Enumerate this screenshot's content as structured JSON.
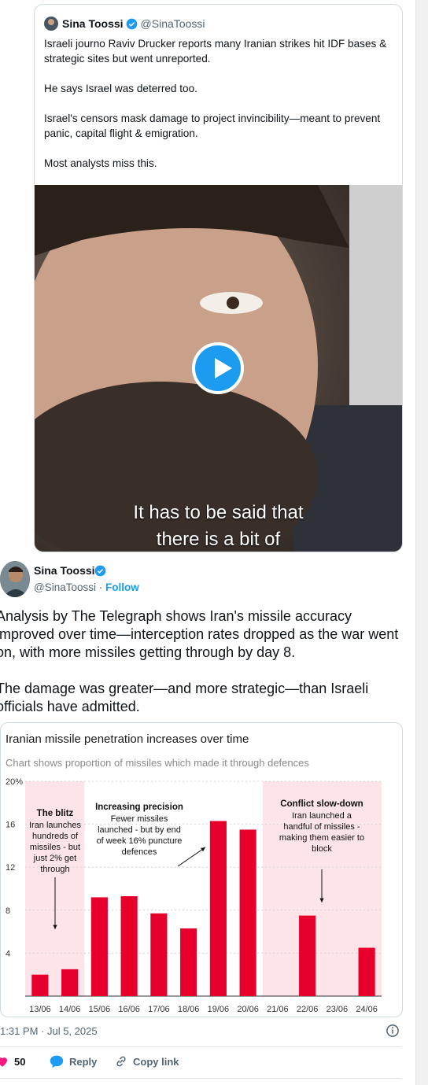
{
  "quoted": {
    "name": "Sina Toossi",
    "handle": "@SinaToossi",
    "text": "Israeli journo Raviv Drucker reports many Iranian strikes hit IDF bases & strategic sites but went unreported.\n\nHe says Israel was deterred too.\n\nIsrael's censors mask damage to project invincibility—meant to prevent panic, capital flight & emigration.\n\nMost analysts miss this.",
    "video_caption_1": "It has to be said that",
    "video_caption_2": "there is a bit of"
  },
  "tweet": {
    "name": "Sina Toossi",
    "handle": "@SinaToossi",
    "separator": " · ",
    "follow": "Follow",
    "text": "Analysis by The Telegraph shows Iran's missile accuracy improved over time—interception rates dropped as the war went on, with more missiles getting through by day 8.\n\nThe damage was greater—and more strategic—than Israeli officials have admitted.",
    "timestamp": "1:31 PM · Jul 5, 2025"
  },
  "actions": {
    "likes": "50",
    "reply": "Reply",
    "copy": "Copy link"
  },
  "colors": {
    "accent": "#1d9bf0",
    "bar": "#e8002d",
    "shade": "#fce4e8",
    "like": "#f91880"
  },
  "chart_data": {
    "type": "bar",
    "title": "Iranian missile penetration increases over time",
    "subtitle": "Chart shows proportion of missiles which made it through defences",
    "categories": [
      "13/06",
      "14/06",
      "15/06",
      "16/06",
      "17/06",
      "18/06",
      "19/06",
      "20/06",
      "21/06",
      "22/06",
      "23/06",
      "24/06"
    ],
    "values": [
      2,
      2.5,
      9.2,
      9.3,
      7.7,
      6.3,
      16.3,
      15.5,
      0,
      7.5,
      0,
      4.5
    ],
    "y_ticks": [
      "20%",
      "16",
      "12",
      "8",
      "4"
    ],
    "ylim": [
      0,
      20
    ],
    "shaded_periods": [
      [
        "13/06",
        "14/06"
      ],
      [
        "21/06",
        "24/06"
      ]
    ],
    "annotations": [
      {
        "title": "The blitz",
        "text": "Iran launches\nhundreds of\nmissiles - but\njust 2% get\nthrough"
      },
      {
        "title": "Increasing precision",
        "text": "Fewer missiles\nlaunched - but by end\nof week 16% puncture\ndefences"
      },
      {
        "title": "Conflict slow-down",
        "text": "Iran launched a\nhandful of missiles -\nmaking them easier to\nblock"
      }
    ]
  }
}
